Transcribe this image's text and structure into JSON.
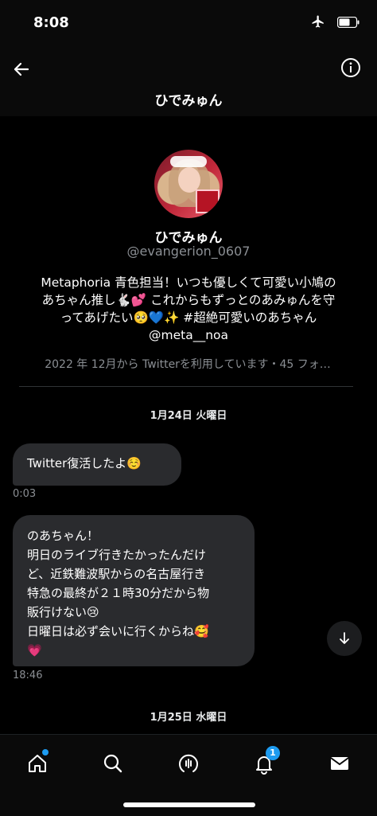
{
  "status_bar": {
    "time": "8:08"
  },
  "header": {
    "title": "ひでみゅん"
  },
  "profile": {
    "name": "ひでみゅん",
    "handle": "@evangerion_0607",
    "bio_lines": [
      "Metaphoria 青色担当！いつも優しくて可愛い小鳩の",
      "あちゃん推し🐇💕 これからもずっとのあみゅんを守",
      "ってあげたい🥺💙✨ #超絶可愛いのあちゃん",
      "@meta__noa"
    ],
    "meta": "2022 年 12月から Twitterを利用しています・45 フォ…"
  },
  "conversation": {
    "date_1": "1月24日 火曜日",
    "message_1": {
      "text": "Twitter復活したよ☺️",
      "time": "0:03"
    },
    "message_2": {
      "text": "のあちゃん！\n明日のライブ行きたかったんだけ\nど、近鉄難波駅からの名古屋行き\n特急の最終が２１時30分だから物\n販行けない😢\n日曜日は必ず会いに行くからね🥰\n💗",
      "time": "18:46"
    },
    "date_2": "1月25日 水曜日"
  },
  "bottom_nav": {
    "items": [
      "home-icon",
      "search-icon",
      "spaces-icon",
      "notifications-icon",
      "messages-icon"
    ],
    "notification_count": "1"
  },
  "colors": {
    "accent": "#1d9bf0",
    "bubble": "#2a2b2e",
    "muted": "#8b8f94"
  }
}
